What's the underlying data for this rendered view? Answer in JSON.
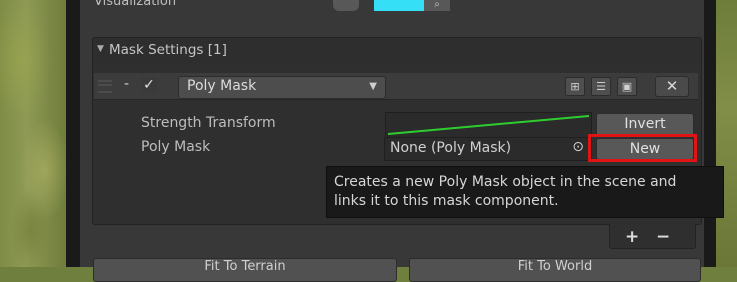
{
  "top": {
    "visualization_label": "Visualization",
    "pick_glyph": "⌕"
  },
  "mask_settings": {
    "title": "Mask Settings [1]",
    "fold_glyph": "▼"
  },
  "mask_item": {
    "remove_glyph": "-",
    "enabled_glyph": "✓",
    "type_selected": "Poly Mask",
    "dropdown_glyph": "▼",
    "tool_buttons": [
      "⊞",
      "☰",
      "▣"
    ],
    "close_glyph": "✕"
  },
  "fields": {
    "strength_label": "Strength Transform",
    "poly_label": "Poly Mask",
    "poly_value": "None (Poly Mask)",
    "picker_glyph": "⊙"
  },
  "buttons": {
    "invert": "Invert",
    "new": "New"
  },
  "tooltip": {
    "line1": "Creates a new Poly Mask object in the scene and",
    "line2": "links it to this mask component."
  },
  "footer": {
    "plus": "+",
    "minus": "−"
  },
  "bottom": {
    "fit_terrain": "Fit To Terrain",
    "fit_world": "Fit To World"
  },
  "colors": {
    "panel": "#383838",
    "curve": "#2ecc2e",
    "highlight": "#e11414",
    "color_swatch": "#35dff5"
  }
}
